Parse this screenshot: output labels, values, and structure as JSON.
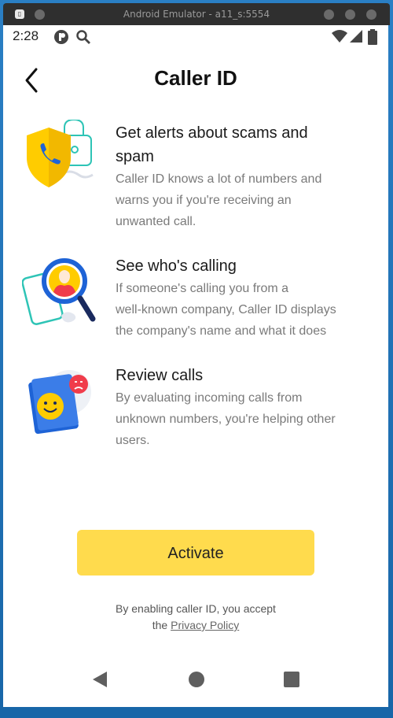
{
  "window": {
    "title": "Android Emulator - a11_s:5554"
  },
  "status_bar": {
    "time": "2:28"
  },
  "header": {
    "title": "Caller ID"
  },
  "features": [
    {
      "title_line1": "Get alerts about scams and",
      "title_line2": "spam",
      "desc_line1": "Caller ID knows a lot of numbers and",
      "desc_line2": "warns you if you're receiving an",
      "desc_line3": "unwanted call.",
      "icon": "shield-phone-icon"
    },
    {
      "title_line1": "See who's calling",
      "desc_line1": "If someone's calling you from a",
      "desc_line2": "well-known company, Caller ID displays",
      "desc_line3": "the company's name and what it does",
      "icon": "magnifier-person-icon"
    },
    {
      "title_line1": "Review calls",
      "desc_line1": "By evaluating incoming calls from",
      "desc_line2": "unknown numbers, you're helping other",
      "desc_line3": "users.",
      "icon": "rating-faces-icon"
    }
  ],
  "activate_label": "Activate",
  "consent": {
    "line1": "By enabling caller ID, you accept",
    "line2_prefix": "the",
    "link_text": "Privacy Policy"
  },
  "colors": {
    "accent": "#ffdb4d",
    "shield": "#ffcc00",
    "teal": "#2ec4b6",
    "blue": "#1e63d6",
    "red": "#f03c4b"
  }
}
